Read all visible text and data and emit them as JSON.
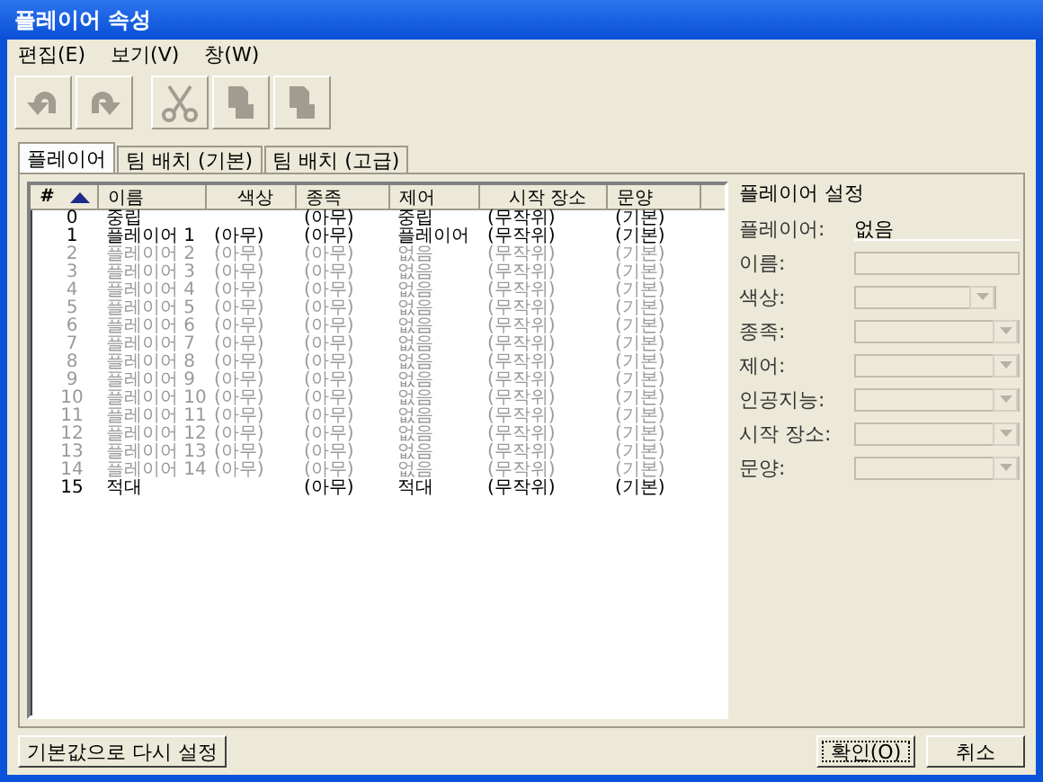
{
  "window": {
    "title": "플레이어 속성"
  },
  "menu": [
    "편집(E)",
    "보기(V)",
    "창(W)"
  ],
  "toolbar": [
    {
      "kind": "undo",
      "disabled": true
    },
    {
      "kind": "redo",
      "disabled": true
    },
    {
      "kind": "cut",
      "disabled": true
    },
    {
      "kind": "copy",
      "disabled": true
    },
    {
      "kind": "paste",
      "disabled": true
    }
  ],
  "tabs": [
    {
      "label": "플레이어",
      "selected": true
    },
    {
      "label": "팀 배치 (기본)",
      "selected": false
    },
    {
      "label": "팀 배치 (고급)",
      "selected": false
    }
  ],
  "table": {
    "columns": [
      "#",
      "이름",
      "색상",
      "종족",
      "제어",
      "시작 장소",
      "문양"
    ],
    "rows": [
      {
        "cells": [
          "0",
          "중립",
          "",
          "(아무)",
          "중립",
          "(무작위)",
          "(기본)"
        ],
        "disabled": false
      },
      {
        "cells": [
          "1",
          "플레이어 1",
          "(아무)",
          "(아무)",
          "플레이어",
          "(무작위)",
          "(기본)"
        ],
        "disabled": false
      },
      {
        "cells": [
          "2",
          "플레이어 2",
          "(아무)",
          "(아무)",
          "없음",
          "(무작위)",
          "(기본)"
        ],
        "disabled": true
      },
      {
        "cells": [
          "3",
          "플레이어 3",
          "(아무)",
          "(아무)",
          "없음",
          "(무작위)",
          "(기본)"
        ],
        "disabled": true
      },
      {
        "cells": [
          "4",
          "플레이어 4",
          "(아무)",
          "(아무)",
          "없음",
          "(무작위)",
          "(기본)"
        ],
        "disabled": true
      },
      {
        "cells": [
          "5",
          "플레이어 5",
          "(아무)",
          "(아무)",
          "없음",
          "(무작위)",
          "(기본)"
        ],
        "disabled": true
      },
      {
        "cells": [
          "6",
          "플레이어 6",
          "(아무)",
          "(아무)",
          "없음",
          "(무작위)",
          "(기본)"
        ],
        "disabled": true
      },
      {
        "cells": [
          "7",
          "플레이어 7",
          "(아무)",
          "(아무)",
          "없음",
          "(무작위)",
          "(기본)"
        ],
        "disabled": true
      },
      {
        "cells": [
          "8",
          "플레이어 8",
          "(아무)",
          "(아무)",
          "없음",
          "(무작위)",
          "(기본)"
        ],
        "disabled": true
      },
      {
        "cells": [
          "9",
          "플레이어 9",
          "(아무)",
          "(아무)",
          "없음",
          "(무작위)",
          "(기본)"
        ],
        "disabled": true
      },
      {
        "cells": [
          "10",
          "플레이어 10",
          "(아무)",
          "(아무)",
          "없음",
          "(무작위)",
          "(기본)"
        ],
        "disabled": true
      },
      {
        "cells": [
          "11",
          "플레이어 11",
          "(아무)",
          "(아무)",
          "없음",
          "(무작위)",
          "(기본)"
        ],
        "disabled": true
      },
      {
        "cells": [
          "12",
          "플레이어 12",
          "(아무)",
          "(아무)",
          "없음",
          "(무작위)",
          "(기본)"
        ],
        "disabled": true
      },
      {
        "cells": [
          "13",
          "플레이어 13",
          "(아무)",
          "(아무)",
          "없음",
          "(무작위)",
          "(기본)"
        ],
        "disabled": true
      },
      {
        "cells": [
          "14",
          "플레이어 14",
          "(아무)",
          "(아무)",
          "없음",
          "(무작위)",
          "(기본)"
        ],
        "disabled": true
      },
      {
        "cells": [
          "15",
          "적대",
          "",
          "(아무)",
          "적대",
          "(무작위)",
          "(기본)"
        ],
        "disabled": false
      }
    ]
  },
  "settings": {
    "title": "플레이어 설정",
    "fields": [
      {
        "label": "플레이어:",
        "kind": "readonly",
        "value": "없음"
      },
      {
        "label": "이름:",
        "kind": "input"
      },
      {
        "label": "색상:",
        "kind": "short-select"
      },
      {
        "label": "종족:",
        "kind": "select"
      },
      {
        "label": "제어:",
        "kind": "select"
      },
      {
        "label": "인공지능:",
        "kind": "select"
      },
      {
        "label": "시작 장소:",
        "kind": "select"
      },
      {
        "label": "문양:",
        "kind": "select"
      }
    ]
  },
  "buttons": {
    "reset": "기본값으로 다시 설정",
    "ok": "확인(O)",
    "cancel": "취소"
  }
}
